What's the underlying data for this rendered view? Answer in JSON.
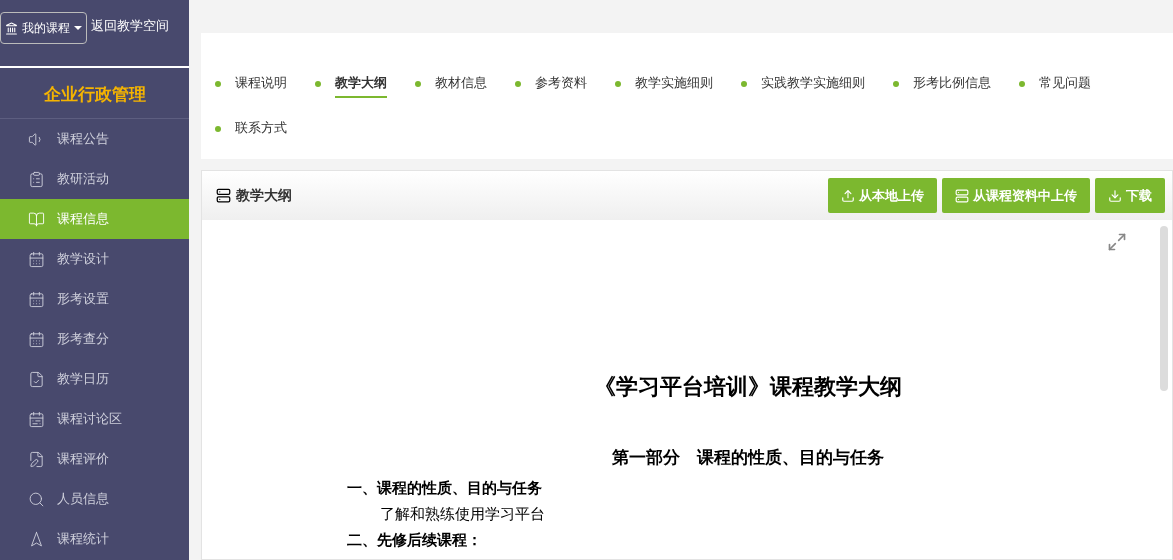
{
  "sidebar": {
    "course_menu": "我的课程",
    "back_link": "返回教学空间",
    "course_title": "企业行政管理",
    "items": [
      {
        "label": "课程公告",
        "selected": false
      },
      {
        "label": "教研活动",
        "selected": false
      },
      {
        "label": "课程信息",
        "selected": true
      },
      {
        "label": "教学设计",
        "selected": false
      },
      {
        "label": "形考设置",
        "selected": false
      },
      {
        "label": "形考查分",
        "selected": false
      },
      {
        "label": "教学日历",
        "selected": false
      },
      {
        "label": "课程讨论区",
        "selected": false
      },
      {
        "label": "课程评价",
        "selected": false
      },
      {
        "label": "人员信息",
        "selected": false
      },
      {
        "label": "课程统计",
        "selected": false
      }
    ]
  },
  "tabs": [
    {
      "label": "课程说明",
      "selected": false
    },
    {
      "label": "教学大纲",
      "selected": true
    },
    {
      "label": "教材信息",
      "selected": false
    },
    {
      "label": "参考资料",
      "selected": false
    },
    {
      "label": "教学实施细则",
      "selected": false
    },
    {
      "label": "实践教学实施细则",
      "selected": false
    },
    {
      "label": "形考比例信息",
      "selected": false
    },
    {
      "label": "常见问题",
      "selected": false
    },
    {
      "label": "联系方式",
      "selected": false
    }
  ],
  "panel": {
    "title": "教学大纲",
    "buttons": [
      {
        "kind": "upload",
        "label": "从本地上传"
      },
      {
        "kind": "library",
        "label": "从课程资料中上传"
      },
      {
        "kind": "download",
        "label": "下载"
      }
    ]
  },
  "document": [
    {
      "kind": "title",
      "text": "《学习平台培训》课程教学大纲"
    },
    {
      "kind": "section",
      "text": "第一部分　课程的性质、目的与任务"
    },
    {
      "kind": "heading",
      "text": "一、课程的性质、目的与任务"
    },
    {
      "kind": "text",
      "text": "了解和熟练使用学习平台"
    },
    {
      "kind": "heading",
      "text": "二、先修后续课程："
    }
  ]
}
